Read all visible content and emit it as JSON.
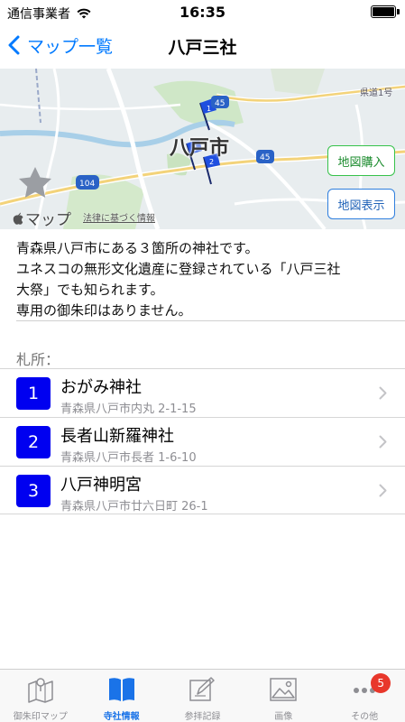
{
  "status_bar": {
    "carrier": "通信事業者",
    "time": "16:35",
    "battery_level": 1.0
  },
  "nav": {
    "back_label": "マップ一覧",
    "title": "八戸三社"
  },
  "map": {
    "city_label": "八戸市",
    "road_label": "県道1号",
    "route_shields": [
      "45",
      "104",
      "45"
    ],
    "pin_labels": [
      "1",
      "3",
      "2"
    ],
    "apple_maps_label": "マップ",
    "legal_link": "法律に基づく情報",
    "buy_button": "地図購入",
    "show_button": "地図表示"
  },
  "description": {
    "line1": "青森県八戸市にある３箇所の神社です。",
    "line2": "ユネスコの無形文化遺産に登録されている「八戸三社",
    "line3": "大祭」でも知られます。",
    "line4": "専用の御朱印はありません。"
  },
  "section_header": "札所：",
  "shrines": [
    {
      "number": "1",
      "name": "おがみ神社",
      "address": "青森県八戸市内丸 2-1-15"
    },
    {
      "number": "2",
      "name": "長者山新羅神社",
      "address": "青森県八戸市長者 1-6-10"
    },
    {
      "number": "3",
      "name": "八戸神明宮",
      "address": "青森県八戸市廿六日町 26-1"
    }
  ],
  "tab_bar": {
    "tabs": [
      {
        "label": "御朱印マップ",
        "icon": "map-icon",
        "active": false
      },
      {
        "label": "寺社情報",
        "icon": "book-icon",
        "active": true
      },
      {
        "label": "参拝記録",
        "icon": "edit-icon",
        "active": false
      },
      {
        "label": "画像",
        "icon": "image-icon",
        "active": false
      },
      {
        "label": "その他",
        "icon": "more-icon",
        "active": false
      }
    ],
    "more_badge": "5"
  },
  "colors": {
    "accent": "#007aff",
    "tab_active": "#1a73e8",
    "number_badge": "#0000f0",
    "buy_border": "#36c24a",
    "show_border": "#2f7fde",
    "badge_red": "#e8372b"
  }
}
